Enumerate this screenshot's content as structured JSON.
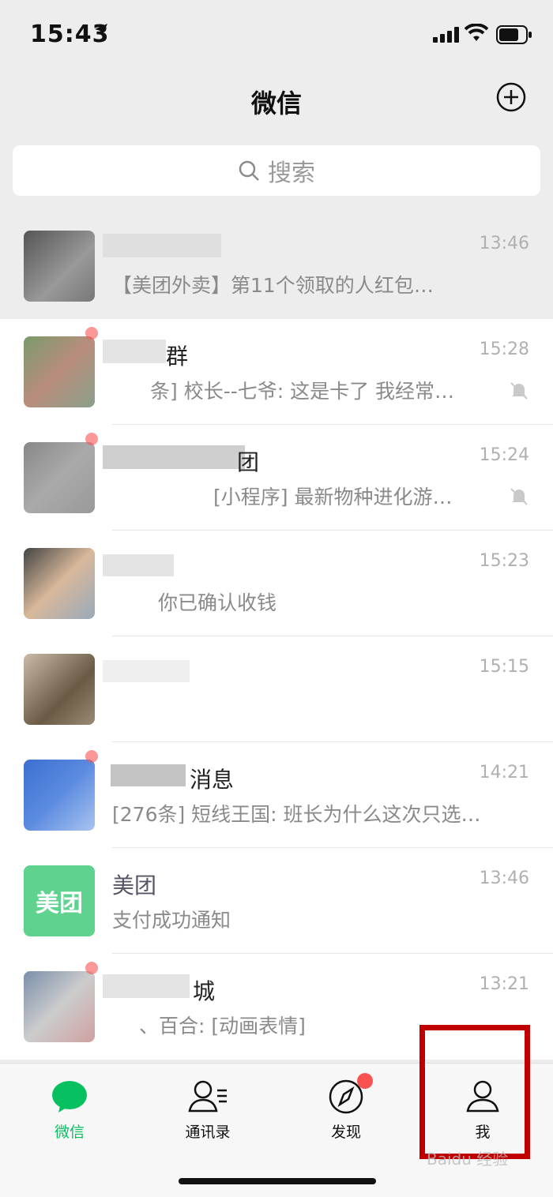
{
  "status": {
    "time": "15:43"
  },
  "header": {
    "title": "微信"
  },
  "search": {
    "placeholder": "搜索"
  },
  "chats": [
    {
      "name": "",
      "preview": "【美团外卖】第11个领取的人红包…",
      "time": "13:46",
      "pinned": true,
      "muted": false
    },
    {
      "name": "群",
      "preview": "条] 校长--七爷: 这是卡了 我经常…",
      "time": "15:28",
      "pinned": false,
      "muted": true
    },
    {
      "name": "团",
      "preview": "[小程序] 最新物种进化游…",
      "time": "15:24",
      "pinned": false,
      "muted": true
    },
    {
      "name": "",
      "preview": "你已确认收钱",
      "time": "15:23",
      "pinned": false,
      "muted": false
    },
    {
      "name": "",
      "preview": "",
      "time": "15:15",
      "pinned": false,
      "muted": false
    },
    {
      "name": "消息",
      "preview": "[276条] 短线王国: 班长为什么这次只选…",
      "time": "14:21",
      "pinned": false,
      "muted": false
    },
    {
      "name": "美团",
      "preview": "支付成功通知",
      "time": "13:46",
      "pinned": false,
      "muted": false
    },
    {
      "name": "城",
      "preview": "、百合: [动画表情]",
      "time": "13:21",
      "pinned": false,
      "muted": true
    }
  ],
  "meituan_logo_text": "美团",
  "tabs": [
    {
      "label": "微信",
      "active": true
    },
    {
      "label": "通讯录",
      "active": false
    },
    {
      "label": "发现",
      "active": false
    },
    {
      "label": "我",
      "active": false
    }
  ],
  "watermark": "Baidu 经验",
  "colors": {
    "accent": "#07c160",
    "badge": "#fa5151",
    "highlight": "#c00000"
  }
}
